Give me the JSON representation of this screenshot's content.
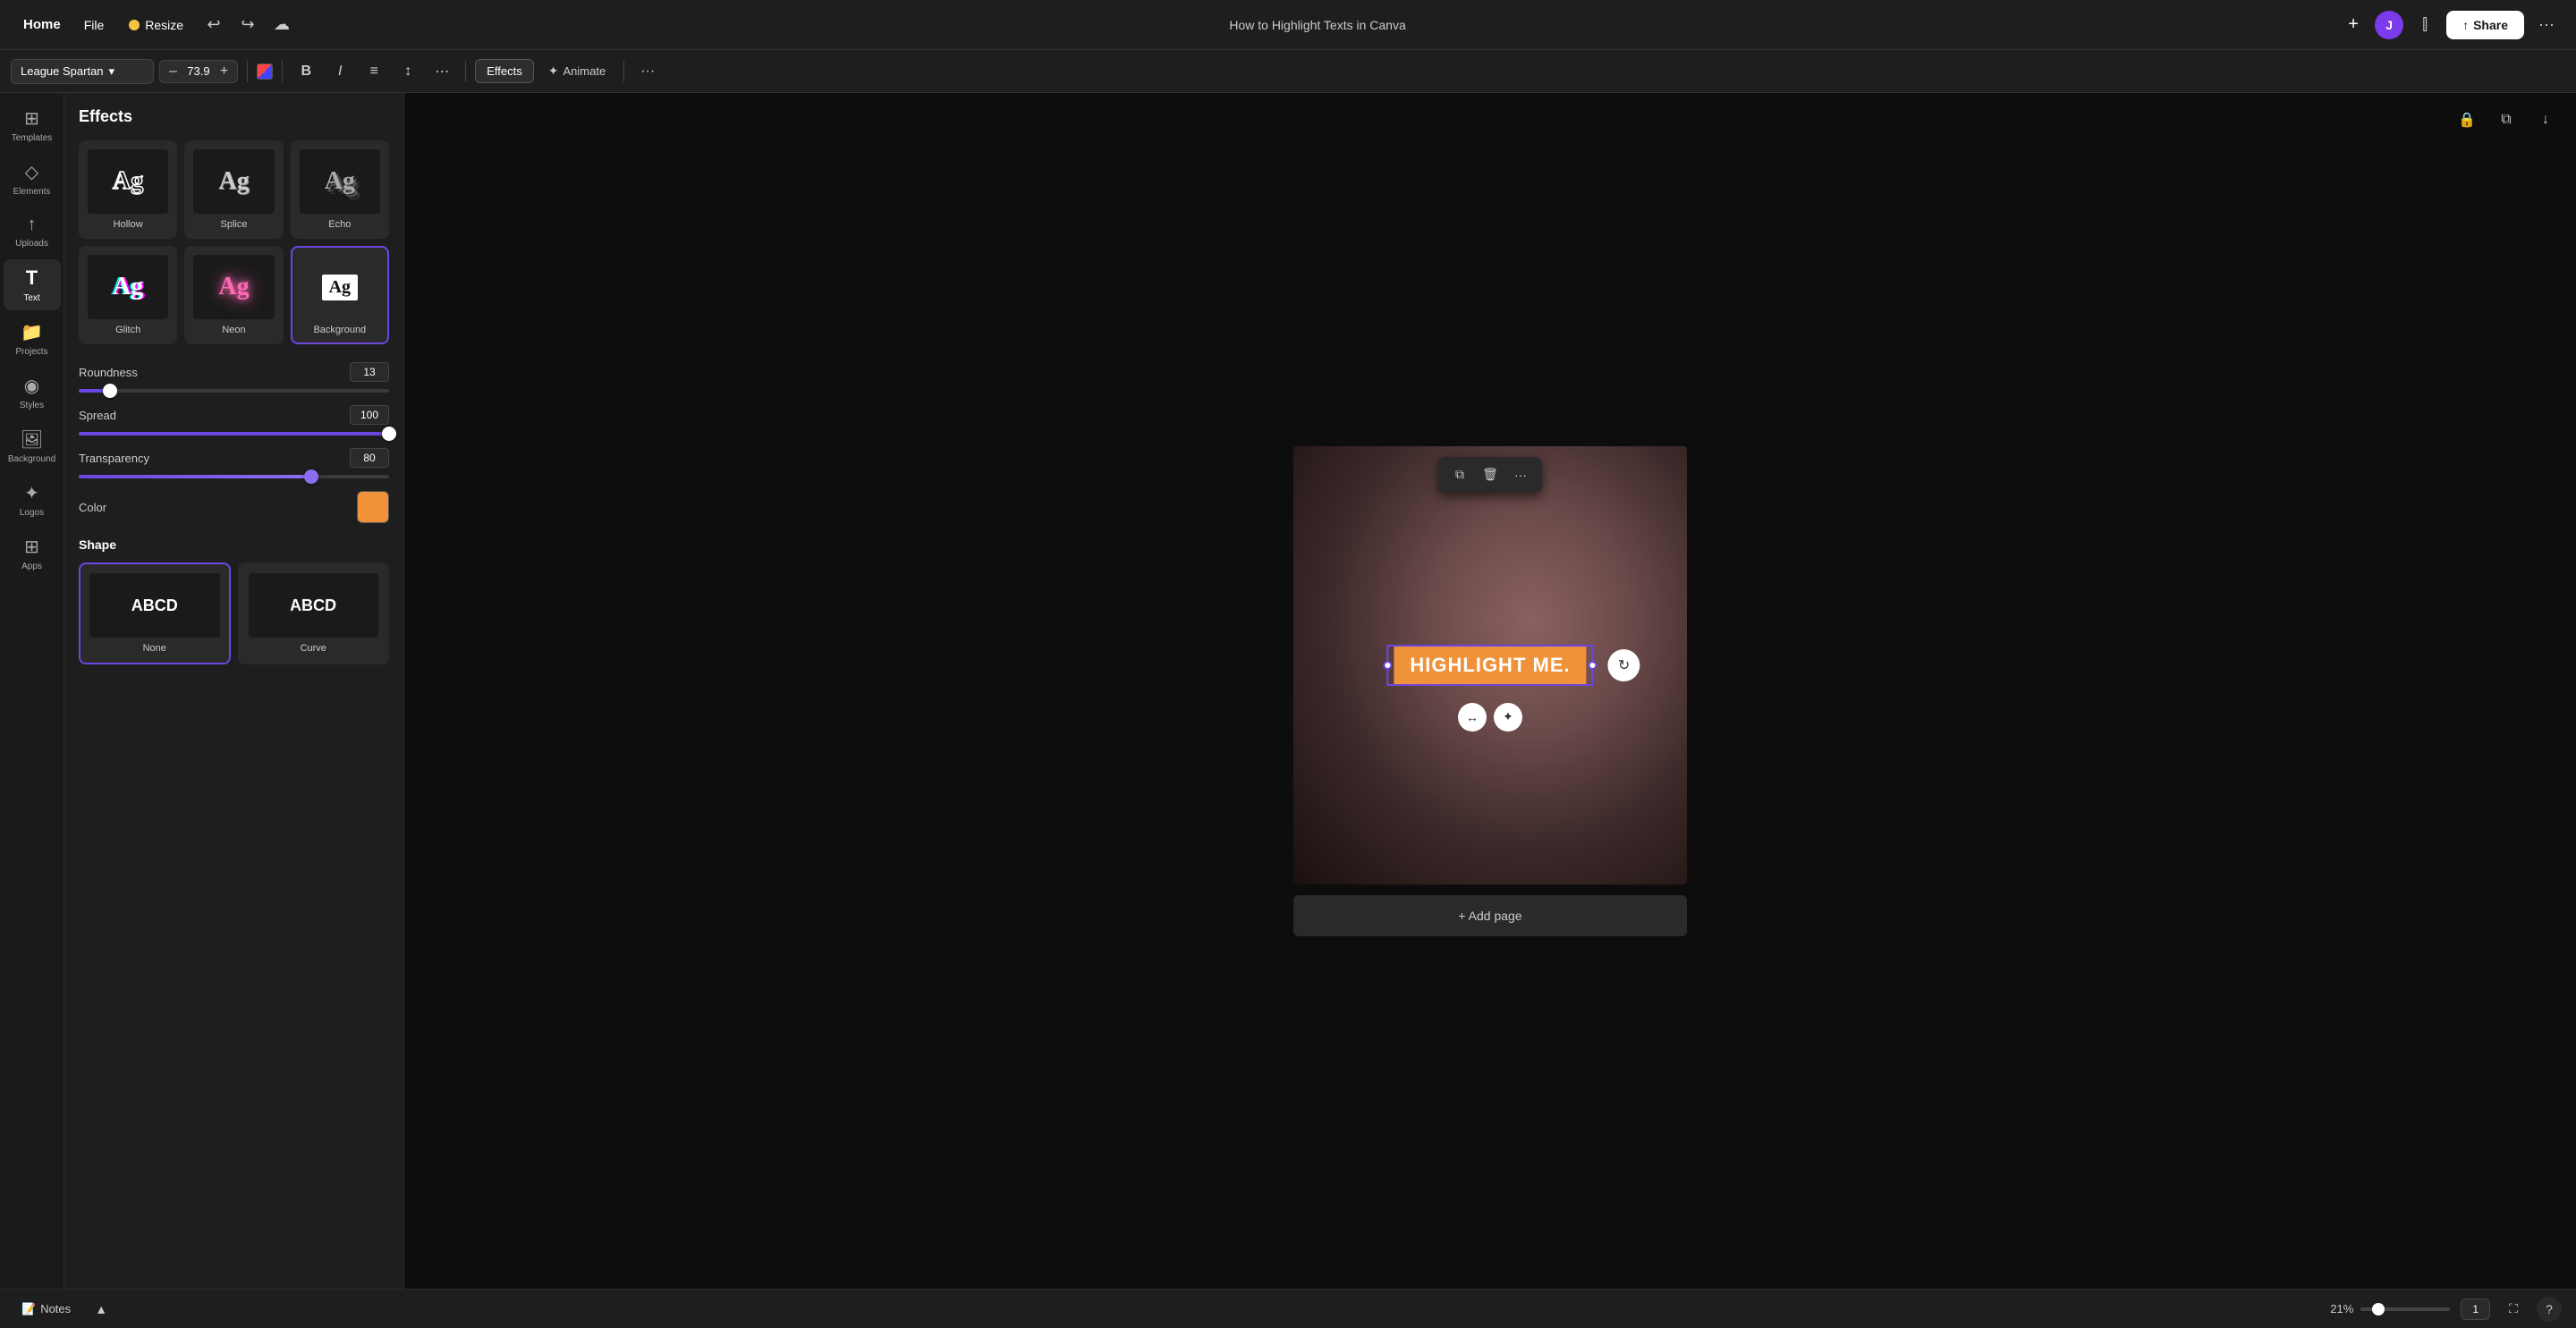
{
  "topbar": {
    "home_label": "Home",
    "file_label": "File",
    "resize_label": "Resize",
    "title": "How to Highlight Texts in Canva",
    "share_label": "Share",
    "avatar_initial": "J",
    "undo_icon": "↩",
    "redo_icon": "↪",
    "cloud_icon": "☁",
    "plus_icon": "+",
    "dots_icon": "···",
    "upload_icon": "↑",
    "people_icon": "👤"
  },
  "toolbar": {
    "font_name": "League Spartan",
    "font_size": "73.9",
    "bold_icon": "B",
    "italic_icon": "I",
    "align_icon": "≡",
    "spacing_icon": "↕",
    "more_icon": "⋯",
    "effects_label": "Effects",
    "animate_icon": "✦",
    "animate_label": "Animate",
    "minus_icon": "–",
    "plus_icon": "+",
    "dropdown_icon": "▾",
    "dots_icon": "···"
  },
  "sidebar": {
    "items": [
      {
        "id": "templates",
        "icon": "⊞",
        "label": "Templates"
      },
      {
        "id": "elements",
        "icon": "◇",
        "label": "Elements"
      },
      {
        "id": "uploads",
        "icon": "↑",
        "label": "Uploads"
      },
      {
        "id": "text",
        "icon": "T",
        "label": "Text"
      },
      {
        "id": "projects",
        "icon": "📁",
        "label": "Projects"
      },
      {
        "id": "styles",
        "icon": "◉",
        "label": "Styles"
      },
      {
        "id": "background",
        "icon": "🖼",
        "label": "Background"
      },
      {
        "id": "logos",
        "icon": "✦",
        "label": "Logos"
      },
      {
        "id": "apps",
        "icon": "⊞",
        "label": "Apps"
      }
    ]
  },
  "effects_panel": {
    "title": "Effects",
    "effects": [
      {
        "id": "hollow",
        "label": "Hollow",
        "preview_text": "Ag",
        "style": "hollow"
      },
      {
        "id": "splice",
        "label": "Splice",
        "preview_text": "Ag",
        "style": "splice"
      },
      {
        "id": "echo",
        "label": "Echo",
        "preview_text": "Ag",
        "style": "echo"
      },
      {
        "id": "glitch",
        "label": "Glitch",
        "preview_text": "Ag",
        "style": "glitch"
      },
      {
        "id": "neon",
        "label": "Neon",
        "preview_text": "Ag",
        "style": "neon"
      },
      {
        "id": "background",
        "label": "Background",
        "preview_text": "Ag",
        "style": "bg",
        "selected": true
      }
    ],
    "sliders": {
      "roundness": {
        "label": "Roundness",
        "value": 13,
        "fill_pct": 10
      },
      "spread": {
        "label": "Spread",
        "value": 100,
        "fill_pct": 100
      },
      "transparency": {
        "label": "Transparency",
        "value": 80,
        "fill_pct": 75
      }
    },
    "color": {
      "label": "Color",
      "value": "#f0923a"
    },
    "shape": {
      "label": "Shape",
      "options": [
        {
          "id": "none",
          "label": "None",
          "preview_text": "ABCD",
          "selected": true
        },
        {
          "id": "curve",
          "label": "Curve",
          "preview_text": "ABCD"
        }
      ]
    }
  },
  "canvas": {
    "float_toolbar": {
      "copy_icon": "⧉",
      "delete_icon": "🗑",
      "dots_icon": "···"
    },
    "text": "HIGHLIGHT ME.",
    "add_page_label": "+ Add page",
    "controls": {
      "rotate_icon": "↻",
      "sub_ctrl1": "↔",
      "sub_ctrl2": "✦"
    }
  },
  "bottombar": {
    "notes_icon": "📝",
    "notes_label": "Notes",
    "collapse_icon": "▲",
    "zoom_label": "21%",
    "page_label": "1",
    "fullscreen_icon": "⛶",
    "help_icon": "?"
  }
}
